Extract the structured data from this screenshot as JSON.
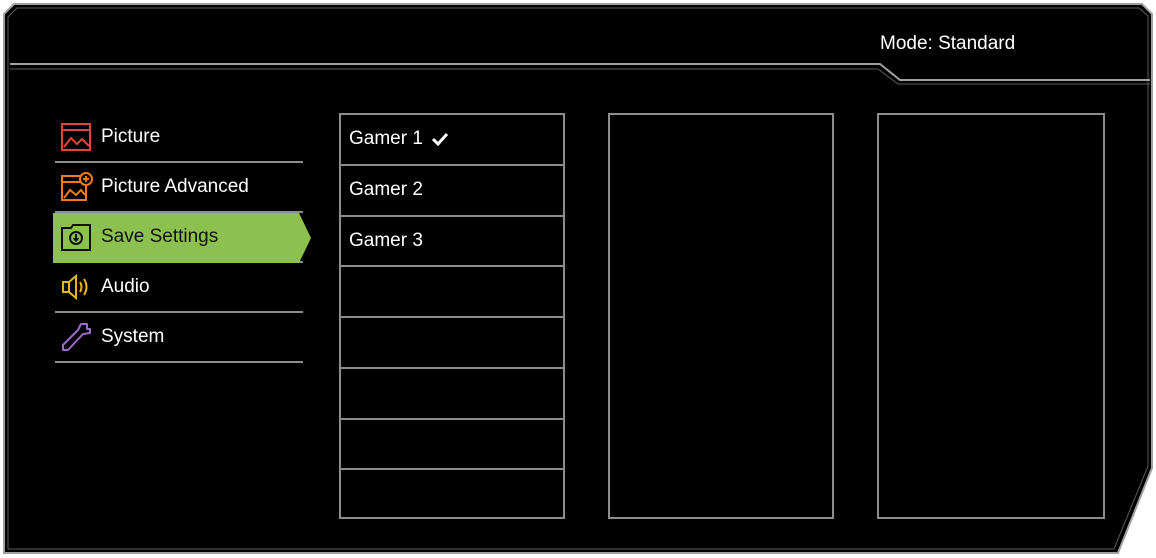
{
  "header": {
    "mode_label": "Mode: Standard"
  },
  "menu": {
    "items": [
      {
        "label": "Picture",
        "icon": "picture-icon",
        "icon_color": "#e4453b",
        "selected": false
      },
      {
        "label": "Picture Advanced",
        "icon": "picture-advanced-icon",
        "icon_color": "#ef7a1a",
        "selected": false
      },
      {
        "label": "Save Settings",
        "icon": "save-settings-icon",
        "icon_color": "#111111",
        "selected": true
      },
      {
        "label": "Audio",
        "icon": "audio-icon",
        "icon_color": "#e8b51a",
        "selected": false
      },
      {
        "label": "System",
        "icon": "system-icon",
        "icon_color": "#9a6bc9",
        "selected": false
      }
    ],
    "selected_color": "#8dc14f"
  },
  "submenu": {
    "items": [
      {
        "label": "Gamer 1",
        "checked": true
      },
      {
        "label": "Gamer 2",
        "checked": false
      },
      {
        "label": "Gamer 3",
        "checked": false
      },
      {
        "label": "",
        "checked": false
      },
      {
        "label": "",
        "checked": false
      },
      {
        "label": "",
        "checked": false
      },
      {
        "label": "",
        "checked": false
      },
      {
        "label": "",
        "checked": false
      }
    ]
  },
  "colors": {
    "background": "#000000",
    "border": "#8c8c8c",
    "text": "#ffffff"
  }
}
